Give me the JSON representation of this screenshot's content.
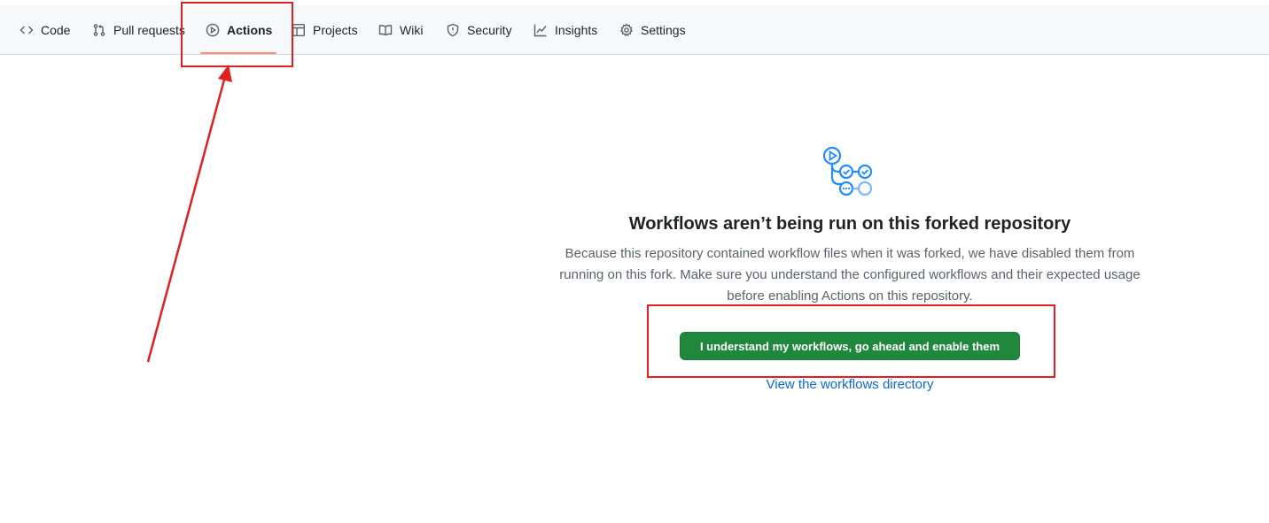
{
  "nav": {
    "items": [
      {
        "label": "Code",
        "icon": "code-icon"
      },
      {
        "label": "Pull requests",
        "icon": "pull-request-icon"
      },
      {
        "label": "Actions",
        "icon": "play-icon",
        "active": true
      },
      {
        "label": "Projects",
        "icon": "table-icon"
      },
      {
        "label": "Wiki",
        "icon": "book-icon"
      },
      {
        "label": "Security",
        "icon": "shield-icon"
      },
      {
        "label": "Insights",
        "icon": "graph-icon"
      },
      {
        "label": "Settings",
        "icon": "gear-icon"
      }
    ],
    "active_underline_color": "#fd8c73"
  },
  "blank_state": {
    "icon": "workflow-icon",
    "title": "Workflows aren’t being run on this forked repository",
    "description": "Because this repository contained workflow files when it was forked, we have disabled them from running on this fork. Make sure you understand the configured workflows and their expected usage before enabling Actions on this repository.",
    "enable_button_label": "I understand my workflows, go ahead and enable them",
    "directory_link_label": "View the workflows directory"
  },
  "colors": {
    "primary_button": "#1f883d",
    "link": "#0969da",
    "annotation": "#e02020",
    "workflow_icon": "#218bff"
  }
}
